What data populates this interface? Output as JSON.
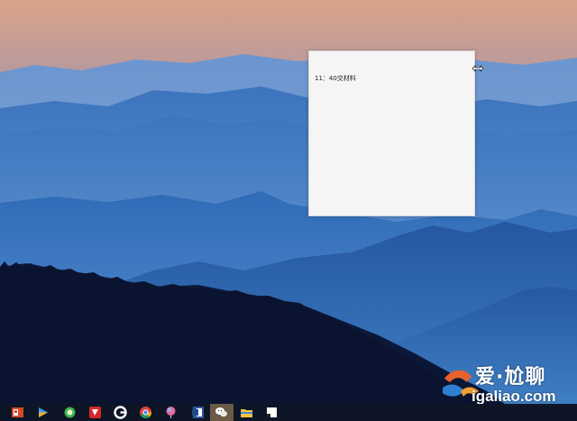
{
  "note": {
    "text": "11：40交材料"
  },
  "watermark": {
    "line1": "爱·尬聊",
    "line2": "igaliao.com"
  },
  "taskbar": {
    "icons": [
      "powerpoint-icon",
      "media-player-icon",
      "green-app-icon",
      "red-app-icon",
      "edge-browser-icon",
      "chrome-icon",
      "balloon-app-icon",
      "word-icon",
      "wechat-icon",
      "file-explorer-icon",
      "sticky-notes-icon"
    ]
  },
  "colors": {
    "sky_top": "#d7a48a",
    "mountain_blue": "#3f7fc9",
    "taskbar": "#0d1526",
    "note_bg": "#f5f5f5"
  }
}
